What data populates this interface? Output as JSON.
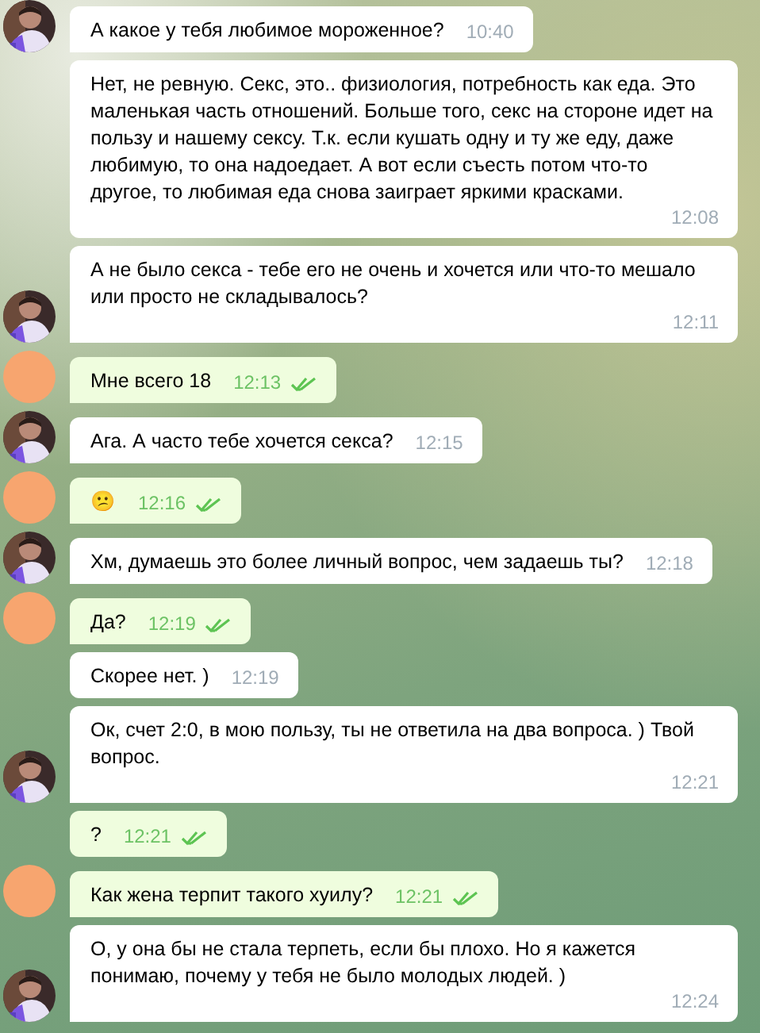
{
  "messages": [
    {
      "kind": "incoming",
      "avatar": true,
      "text": "А какое у тебя любимое мороженное?",
      "time": "10:40"
    },
    {
      "kind": "incoming",
      "avatar": false,
      "text": "Нет, не ревную. Секс, это.. физиология, потребность как еда. Это маленькая часть отношений. Больше того, секс на стороне идет на пользу и нашему сексу. Т.к. если кушать одну и ту же еду, даже любимую, то она надоедает. А вот если съесть потом что-то другое, то любимая еда снова заиграет яркими красками.",
      "time": "12:08"
    },
    {
      "kind": "incoming",
      "avatar": true,
      "text": "А не было секса  - тебе его не очень и хочется или что-то мешало или просто не складывалось?",
      "time": "12:11"
    },
    {
      "kind": "outgoing",
      "avatar": true,
      "read": true,
      "text": "Мне всего 18",
      "time": "12:13"
    },
    {
      "kind": "incoming",
      "avatar": true,
      "text": "Ага. А часто тебе хочется секса?",
      "time": "12:15"
    },
    {
      "kind": "outgoing",
      "avatar": true,
      "read": true,
      "text": "😕",
      "time": "12:16"
    },
    {
      "kind": "incoming",
      "avatar": true,
      "text": "Хм, думаешь это более личный вопрос, чем задаешь ты?",
      "time": "12:18"
    },
    {
      "kind": "outgoing",
      "avatar": true,
      "read": true,
      "text": "Да?",
      "time": "12:19"
    },
    {
      "kind": "incoming",
      "avatar": false,
      "text": "Скорее нет. )",
      "time": "12:19"
    },
    {
      "kind": "incoming",
      "avatar": true,
      "text": "Ок, счет 2:0, в мою пользу, ты не ответила на два вопроса. ) Твой вопрос.",
      "time": "12:21"
    },
    {
      "kind": "outgoing",
      "avatar": false,
      "read": true,
      "text": "?",
      "time": "12:21"
    },
    {
      "kind": "outgoing",
      "avatar": true,
      "read": true,
      "text": "Как жена терпит такого хуилу?",
      "time": "12:21"
    },
    {
      "kind": "incoming",
      "avatar": true,
      "text": "О, у она бы не стала терпеть, если бы плохо. Но я кажется понимаю, почему у тебя не было молодых людей. )",
      "time": "12:24"
    }
  ]
}
